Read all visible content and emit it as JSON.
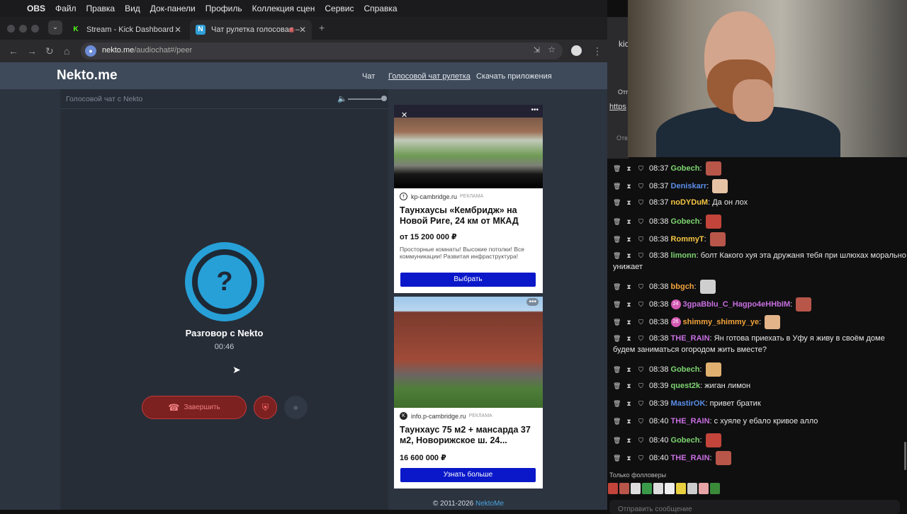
{
  "menubar": {
    "app": "OBS",
    "items": [
      "Файл",
      "Правка",
      "Вид",
      "Док-панели",
      "Профиль",
      "Коллекция сцен",
      "Сервис",
      "Справка"
    ]
  },
  "browser": {
    "tabs": [
      {
        "label": "Stream - Kick Dashboard",
        "favicon": "K"
      },
      {
        "label": "Чат рулетка голосовая –",
        "favicon": "N"
      }
    ],
    "url_host": "nekto.me",
    "url_path": "/audiochat#/peer"
  },
  "site": {
    "logo": "Nekto.me",
    "nav": [
      "Чат",
      "Голосовой чат рулетка",
      "Скачать приложения"
    ],
    "panel_title": "Голосовой чат с Nekto",
    "avatar_glyph": "?",
    "peer_name": "Разговор с Nekto",
    "timer": "00:46",
    "end_label": "Завершить",
    "copyright_prefix": "© 2011-2026 ",
    "copyright_brand": "NektoMe",
    "colors": {
      "accent": "#27a0d8",
      "danger": "#c53a3a",
      "cta": "#0a18c9"
    }
  },
  "ads": [
    {
      "source": "kp-cambridge.ru",
      "tag": "РЕКЛАМА",
      "title": "Таунхаусы «Кембридж» на Новой Риге, 24 км от МКАД",
      "price": "от 15 200 000 ₽",
      "desc": "Просторные комнаты! Высокие потолки! Все коммуникации! Развитая инфраструктура!",
      "cta": "Выбрать"
    },
    {
      "source": "info.p-cambridge.ru",
      "tag": "РЕКЛАМА",
      "title": "Таунхаус 75 м2 + мансарда 37 м2, Новорижское ш. 24...",
      "price": "16 600 000 ₽",
      "cta": "Узнать больше"
    }
  ],
  "right_snippets": [
    "kic",
    "Отп",
    "https",
    "Отв"
  ],
  "chat": [
    {
      "time": "08:37",
      "user": "Gobech",
      "color": "#7dd56f",
      "text": "",
      "emote": "#b8564a"
    },
    {
      "time": "08:37",
      "user": "Deniskarr",
      "color": "#5a8ee8",
      "text": "",
      "emote": "#e7c3a5"
    },
    {
      "time": "08:37",
      "user": "noDYDuM",
      "color": "#f5c542",
      "text": "Да он лох"
    },
    {
      "time": "08:38",
      "user": "Gobech",
      "color": "#7dd56f",
      "text": "",
      "emote": "#c2443a"
    },
    {
      "time": "08:38",
      "user": "RommyT",
      "color": "#f5c542",
      "text": "",
      "emote": "#b8564a"
    },
    {
      "time": "08:38",
      "user": "limonn",
      "color": "#7dd56f",
      "text": "болт Какого хуя эта дружаня тебя при шлюхах морально унижает"
    },
    {
      "time": "08:38",
      "user": "bbgch",
      "color": "#f2a33a",
      "text": "",
      "emote": "#cfcfcf"
    },
    {
      "time": "08:38",
      "user": "3gpaBblu_C_Hagpo4eHHbIM",
      "color": "#c86fe0",
      "text": "",
      "emote": "#b8564a",
      "sub": "24"
    },
    {
      "time": "08:38",
      "user": "shimmy_shimmy_ye",
      "color": "#f2a33a",
      "text": "",
      "emote": "#e3b48a",
      "sub": "26"
    },
    {
      "time": "08:38",
      "user": "THE_RAIN",
      "color": "#c86fe0",
      "text": "Ян готова приехать в Уфу я живу в своём доме будем заниматься огородом жить вместе?"
    },
    {
      "time": "08:38",
      "user": "Gobech",
      "color": "#7dd56f",
      "text": "",
      "emote": "#e0b070"
    },
    {
      "time": "08:39",
      "user": "quest2k",
      "color": "#7dd56f",
      "text": "жиган лимон"
    },
    {
      "time": "08:39",
      "user": "MastirOK",
      "color": "#5a8ee8",
      "text": "привет братик"
    },
    {
      "time": "08:40",
      "user": "THE_RAIN",
      "color": "#c86fe0",
      "text": "с хуяле у ебало кривое алло"
    },
    {
      "time": "08:40",
      "user": "Gobech",
      "color": "#7dd56f",
      "text": "",
      "emote": "#c2443a"
    },
    {
      "time": "08:40",
      "user": "THE_RAIN",
      "color": "#c86fe0",
      "text": "",
      "emote": "#b8564a"
    }
  ],
  "followers_label": "Только фолловеры",
  "chat_input_placeholder": "Отправить сообщение"
}
